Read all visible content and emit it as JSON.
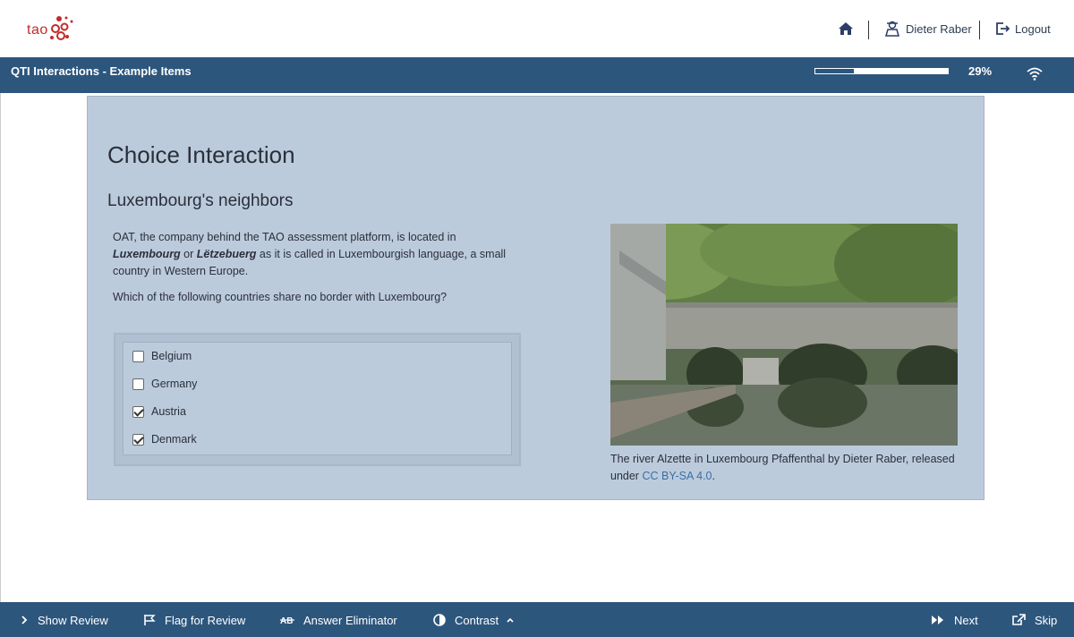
{
  "header": {
    "logo_text": "tao",
    "user_name": "Dieter Raber",
    "logout_label": "Logout"
  },
  "test_bar": {
    "title": "QTI Interactions - Example Items",
    "progress_percent": 29,
    "progress_label": "29%"
  },
  "item": {
    "title": "Choice Interaction",
    "subtitle": "Luxembourg's neighbors",
    "intro_1": "OAT, the company behind the TAO assessment platform, is located in ",
    "intro_lux": "Luxembourg",
    "intro_or": " or ",
    "intro_letz": "Lëtzebuerg",
    "intro_2": " as it is called in Luxembourgish language, a small country in Western Europe.",
    "question": "Which of the following countries share no border with Luxembourg?",
    "choices": [
      {
        "label": "Belgium",
        "checked": false
      },
      {
        "label": "Germany",
        "checked": false
      },
      {
        "label": "Austria",
        "checked": true
      },
      {
        "label": "Denmark",
        "checked": true
      }
    ],
    "caption_1": "The river Alzette in Luxembourg Pfaffenthal by Dieter Raber, released under ",
    "caption_link": "CC BY-SA 4.0",
    "caption_end": "."
  },
  "toolbar": {
    "show_review": "Show Review",
    "flag_review": "Flag for Review",
    "answer_eliminator": "Answer Eliminator",
    "contrast": "Contrast",
    "next": "Next",
    "skip": "Skip"
  },
  "colors": {
    "brand_bar": "#2d567d",
    "item_bg": "#bccbdc",
    "logo": "#c32a2a"
  }
}
